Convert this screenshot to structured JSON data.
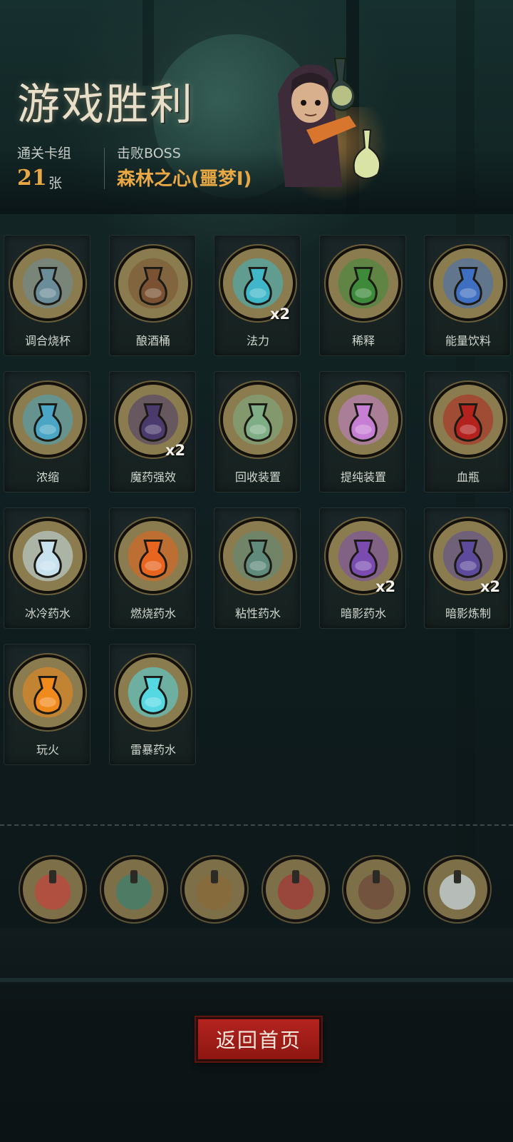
{
  "header": {
    "title": "游戏胜利",
    "deck_label": "通关卡组",
    "deck_count": "21",
    "deck_unit": "张",
    "boss_label": "击败BOSS",
    "boss_name": "森林之心(噩梦I)"
  },
  "cards": [
    {
      "name": "调合烧杯",
      "mult": "",
      "icon": "beaker-icon",
      "color": "#6b8d9a"
    },
    {
      "name": "酿酒桶",
      "mult": "",
      "icon": "barrel-icon",
      "color": "#7a5233"
    },
    {
      "name": "法力",
      "mult": "x2",
      "icon": "mana-orb-icon",
      "color": "#3fb7c9"
    },
    {
      "name": "稀释",
      "mult": "",
      "icon": "cauldron-icon",
      "color": "#3d8a3a"
    },
    {
      "name": "能量饮料",
      "mult": "",
      "icon": "energy-drink-icon",
      "color": "#3f6fc1"
    },
    {
      "name": "浓缩",
      "mult": "",
      "icon": "distiller-icon",
      "color": "#4aa6c4"
    },
    {
      "name": "魔药强效",
      "mult": "x2",
      "icon": "hooded-alchemist-icon",
      "color": "#4b3a6e"
    },
    {
      "name": "回收装置",
      "mult": "",
      "icon": "recycler-icon",
      "color": "#7fae86"
    },
    {
      "name": "提纯装置",
      "mult": "",
      "icon": "purifier-icon",
      "color": "#c77fd6"
    },
    {
      "name": "血瓶",
      "mult": "",
      "icon": "blood-flask-icon",
      "color": "#b3221d"
    },
    {
      "name": "冰冷药水",
      "mult": "",
      "icon": "ice-potion-icon",
      "color": "#c8e2ee"
    },
    {
      "name": "燃烧药水",
      "mult": "",
      "icon": "fire-potion-icon",
      "color": "#e7651e"
    },
    {
      "name": "粘性药水",
      "mult": "",
      "icon": "sticky-potion-icon",
      "color": "#5f8a7c"
    },
    {
      "name": "暗影药水",
      "mult": "x2",
      "icon": "shadow-potion-icon",
      "color": "#7a4cb0"
    },
    {
      "name": "暗影炼制",
      "mult": "x2",
      "icon": "shadow-craft-icon",
      "color": "#5d4a9a"
    },
    {
      "name": "玩火",
      "mult": "",
      "icon": "fire-play-icon",
      "color": "#f08a1c"
    },
    {
      "name": "雷暴药水",
      "mult": "",
      "icon": "storm-potion-icon",
      "color": "#56d8e3"
    }
  ],
  "relics": [
    {
      "icon": "companions-relic-icon",
      "color": "#c2453f"
    },
    {
      "icon": "lantern-relic-icon",
      "color": "#3d7f6c"
    },
    {
      "icon": "gourd-relic-icon",
      "color": "#8a6a3a"
    },
    {
      "icon": "vampire-relic-icon",
      "color": "#a33a3a"
    },
    {
      "icon": "jars-relic-icon",
      "color": "#6f4a3a"
    },
    {
      "icon": "dagger-relic-icon",
      "color": "#c9d7de"
    }
  ],
  "actions": {
    "home_label": "返回首页"
  }
}
